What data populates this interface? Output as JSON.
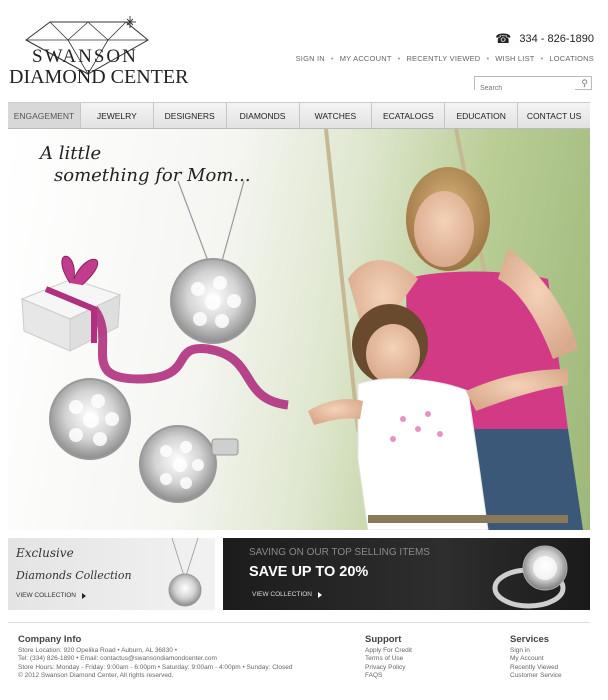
{
  "logo": {
    "line1": "SWANSON",
    "line2": "DIAMOND CENTER"
  },
  "phone": {
    "number": "334 - 826-1890",
    "icon": "telephone-icon"
  },
  "top_links": [
    "SIGN IN",
    "MY ACCOUNT",
    "RECENTLY VIEWED",
    "WISH LIST",
    "LOCATIONS"
  ],
  "search": {
    "placeholder": "Search",
    "icon": "search-icon"
  },
  "nav": {
    "items": [
      "ENGAGEMENT",
      "JEWELRY",
      "DESIGNERS",
      "DIAMONDS",
      "WATCHES",
      "ECATALOGS",
      "EDUCATION",
      "CONTACT US"
    ],
    "active_index": 0
  },
  "hero": {
    "tagline_line1": "A little",
    "tagline_line2": "something for Mom..."
  },
  "promo_left": {
    "title1": "Exclusive",
    "title2": "Diamonds Collection",
    "link": "VIEW COLLECTION"
  },
  "promo_right": {
    "eyebrow": "SAVING ON OUR TOP SELLING ITEMS",
    "headline": "SAVE UP TO 20%",
    "link": "VIEW COLLECTION"
  },
  "footer": {
    "company": {
      "heading": "Company Info",
      "lines": [
        "Store Location: 920 Opelika Road • Auburn,  AL  36830 •",
        "Tel: (334) 826-1890 • Email: contactus@swansondiamondcenter.com",
        "Store Hours: Monday - Friday: 9:00am - 6:00pm • Saturday: 9:00am - 4:00pm • Sunday: Closed",
        "© 2012 Swanson Diamond Center, All rights reserved."
      ]
    },
    "support": {
      "heading": "Support",
      "links": [
        "Apply For Credit",
        "Terms of Use",
        "Privacy Policy",
        "FAQS"
      ]
    },
    "services": {
      "heading": "Services",
      "links": [
        "Sign in",
        "My Account",
        "Recently Viewed",
        "Customer Service"
      ]
    }
  },
  "colors": {
    "ribbon": "#b0307f",
    "shirt": "#d33a86",
    "nav_bg": "#e8e8e8",
    "promo_dark": "#222222"
  }
}
